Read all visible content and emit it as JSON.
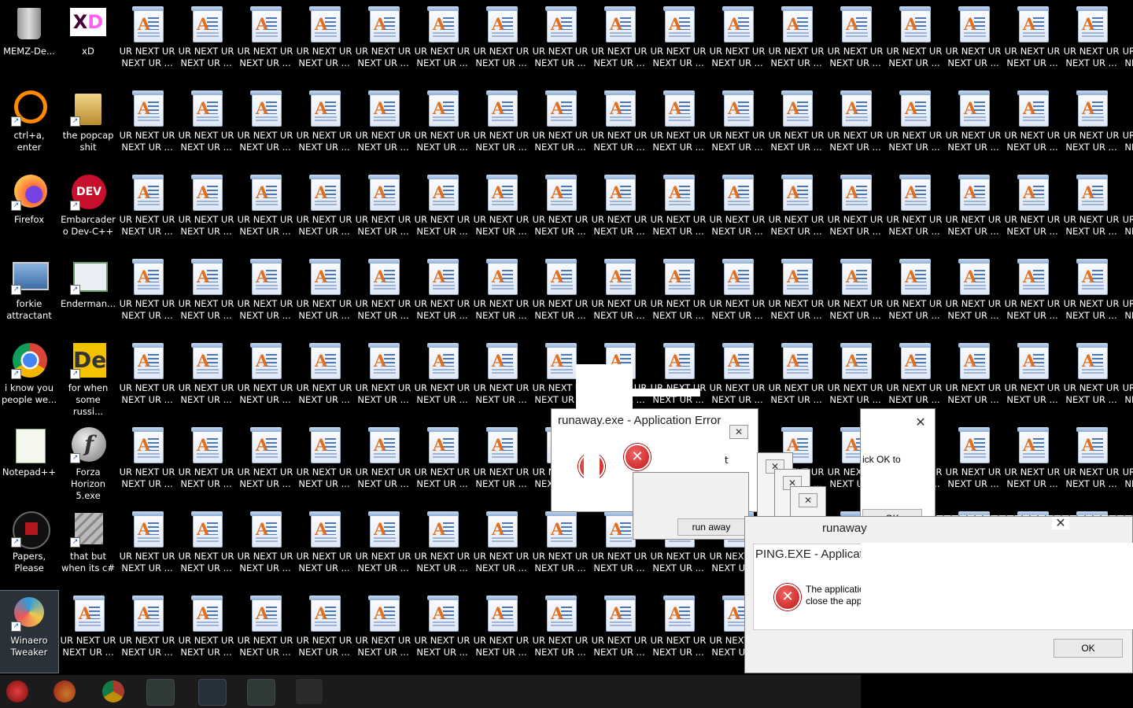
{
  "desktop": {
    "fixed_icons": [
      {
        "label": "MEMZ-De...",
        "icon": "recycle-bin-icon"
      },
      {
        "label": "xD",
        "icon": "adobe-xd-icon"
      },
      {
        "label": "ctrl+a, enter",
        "icon": "orange-ring-icon"
      },
      {
        "label": "the popcap shit",
        "icon": "folder-icon"
      },
      {
        "label": "Firefox",
        "icon": "firefox-icon"
      },
      {
        "label": "Embarcadero Dev-C++",
        "icon": "devcpp-icon"
      },
      {
        "label": "forkie attractant",
        "icon": "settings-monitor-icon"
      },
      {
        "label": "Enderman...",
        "icon": "window-app-icon"
      },
      {
        "label": "i know you people we...",
        "icon": "chrome-icon"
      },
      {
        "label": "for when some russi...",
        "icon": "dreamweaver-icon"
      },
      {
        "label": "Notepad++",
        "icon": "notepadpp-icon"
      },
      {
        "label": "Forza Horizon 5.exe",
        "icon": "flash-icon"
      },
      {
        "label": "Papers, Please",
        "icon": "papers-please-icon"
      },
      {
        "label": "that but when its c#",
        "icon": "stacked-windows-icon"
      },
      {
        "label": "Winaero Tweaker",
        "icon": "winaero-icon"
      }
    ],
    "spam_label": "UR NEXT UR NEXT UR ...",
    "spam_label_short": "UR NEXT UR NEXT UR",
    "spam_icon": "text-document-icon"
  },
  "dialogs": {
    "d1_title": "runaway.exe - Application Error",
    "d1_button": "run away",
    "d1_text": "t",
    "d2_text": "ick OK to",
    "d2_ok": "OK",
    "d3_title": "runaway",
    "d3_subtitle": "PING.EXE - Applicati",
    "d3_msg_line1": "The applicatio",
    "d3_msg_line2": "close the app",
    "d3_ok": "OK"
  },
  "taskbar": {
    "items": [
      "memz-start-icon",
      "firefox-icon",
      "chrome-icon",
      "window-task-icon",
      "visual-studio-icon",
      "window-task-icon",
      "settings-task-icon"
    ]
  }
}
